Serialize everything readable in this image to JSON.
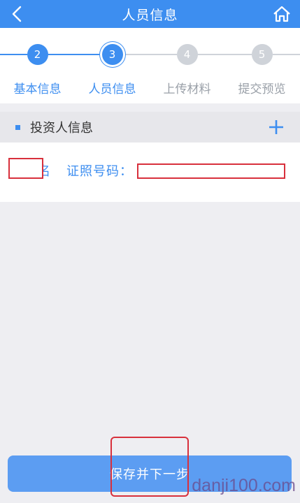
{
  "header": {
    "title": "人员信息"
  },
  "steps": [
    {
      "number": "2",
      "label": "基本信息",
      "state": "done"
    },
    {
      "number": "3",
      "label": "人员信息",
      "state": "current"
    },
    {
      "number": "4",
      "label": "上传材料",
      "state": "todo"
    },
    {
      "number": "5",
      "label": "提交预览",
      "state": "todo"
    }
  ],
  "section": {
    "title": "投资人信息"
  },
  "row": {
    "name_label": "名",
    "id_label": "证照号码："
  },
  "footer": {
    "submit_label": "保存并下一步"
  },
  "watermark": "danji100.com",
  "colors": {
    "primary": "#3d8ef0",
    "button": "#5c9df2",
    "annotation": "#d8303c"
  }
}
